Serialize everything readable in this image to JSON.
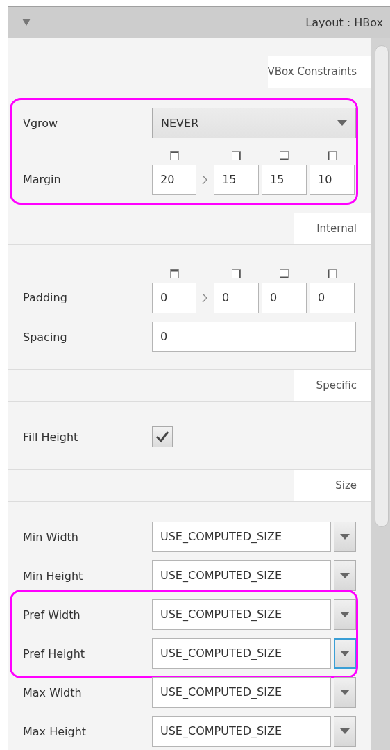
{
  "header": {
    "title": "Layout : HBox",
    "expanded": true
  },
  "sections": [
    {
      "title": "VBox Constraints",
      "groups": [
        {
          "highlighted": true,
          "rows": [
            {
              "kind": "combo",
              "label": "Vgrow",
              "value": "NEVER"
            },
            {
              "kind": "insets",
              "label": "Margin",
              "values": [
                "20",
                "15",
                "15",
                "10"
              ]
            }
          ]
        }
      ]
    },
    {
      "title": "Internal",
      "groups": [
        {
          "highlighted": false,
          "rows": [
            {
              "kind": "insets",
              "label": "Padding",
              "values": [
                "0",
                "0",
                "0",
                "0"
              ]
            },
            {
              "kind": "text",
              "label": "Spacing",
              "value": "0"
            }
          ]
        }
      ]
    },
    {
      "title": "Specific",
      "groups": [
        {
          "highlighted": false,
          "rows": [
            {
              "kind": "checkbox",
              "label": "Fill Height",
              "checked": true
            }
          ]
        }
      ]
    },
    {
      "title": "Size",
      "groups": [
        {
          "highlighted": false,
          "rows": [
            {
              "kind": "size",
              "label": "Min Width",
              "value": "USE_COMPUTED_SIZE",
              "focused": false
            },
            {
              "kind": "size",
              "label": "Min Height",
              "value": "USE_COMPUTED_SIZE",
              "focused": false
            }
          ]
        },
        {
          "highlighted": true,
          "rows": [
            {
              "kind": "size",
              "label": "Pref Width",
              "value": "USE_COMPUTED_SIZE",
              "focused": false
            },
            {
              "kind": "size",
              "label": "Pref Height",
              "value": "USE_COMPUTED_SIZE",
              "focused": true
            }
          ]
        },
        {
          "highlighted": false,
          "rows": [
            {
              "kind": "size",
              "label": "Max Width",
              "value": "USE_COMPUTED_SIZE",
              "focused": false
            },
            {
              "kind": "size",
              "label": "Max Height",
              "value": "USE_COMPUTED_SIZE",
              "focused": false
            }
          ]
        }
      ]
    }
  ]
}
